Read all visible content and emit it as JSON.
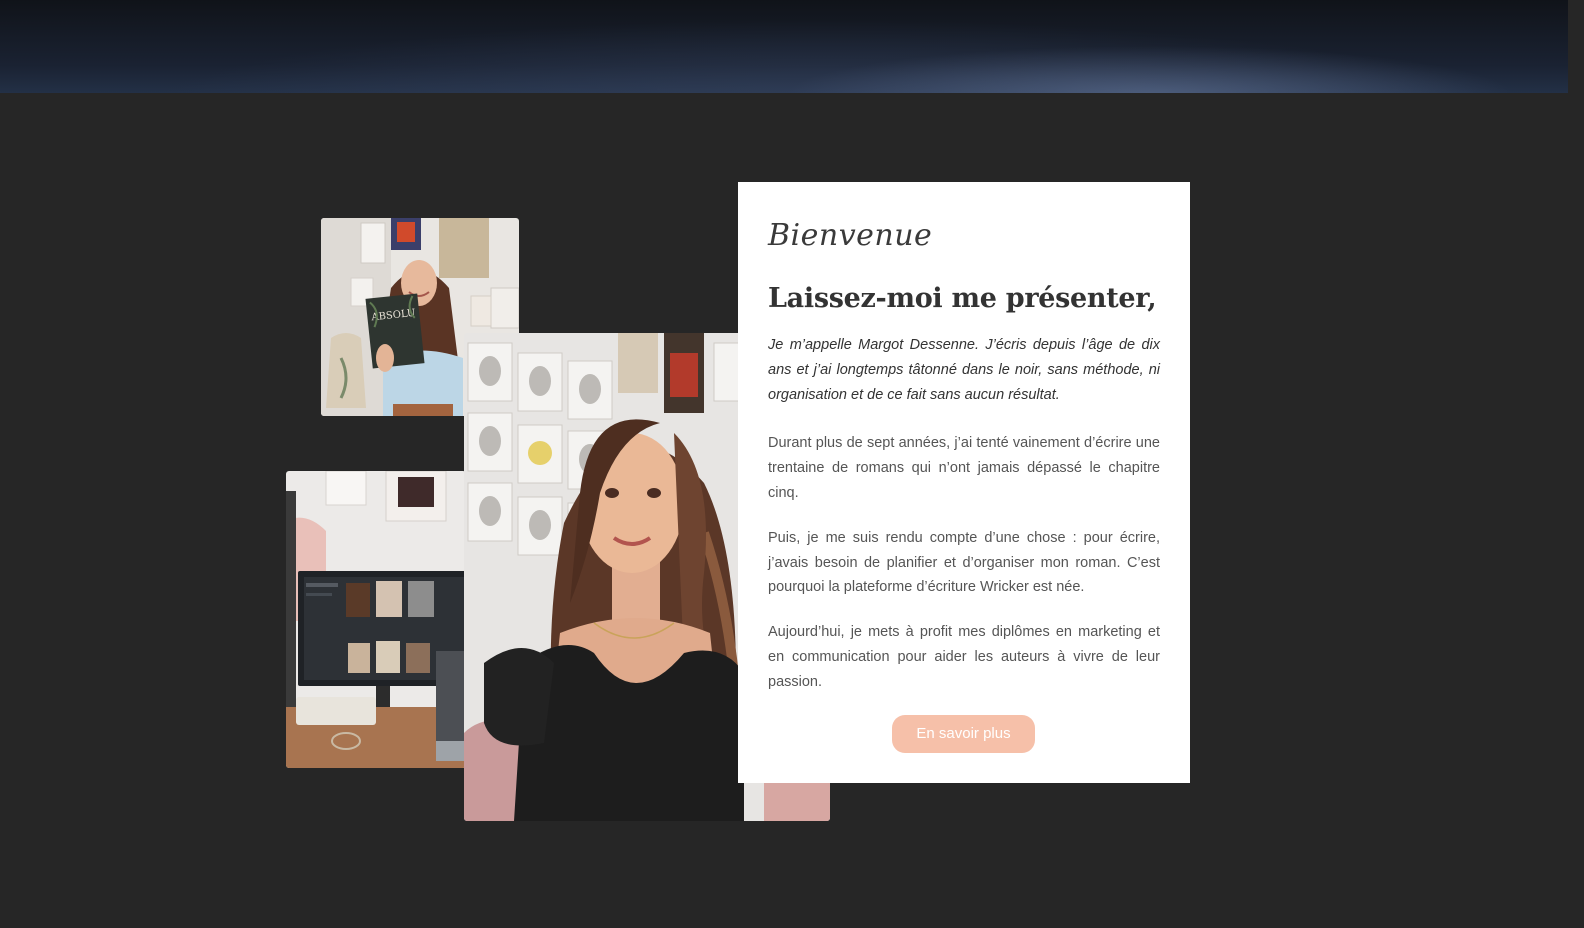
{
  "hero": {
    "background": "dark starry night gradient"
  },
  "gallery": {
    "photos": [
      {
        "name": "author-holding-book-photo",
        "subject": "woman holding a book titled ABSOLU"
      },
      {
        "name": "desk-monitor-photo",
        "subject": "desk with monitor showing character portraits"
      },
      {
        "name": "author-portrait-photo",
        "subject": "smiling woman in black top in front of drawings wall"
      }
    ],
    "book_cover_text": "ABSOLU"
  },
  "about": {
    "eyebrow": "Bienvenue",
    "title": "Laissez-moi me présenter,",
    "intro": "Je m’appelle Margot Dessenne. J’écris depuis l’âge de dix ans et j’ai longtemps tâtonné dans le noir, sans méthode, ni organisation et de ce fait sans aucun résultat.",
    "paragraphs": [
      "Durant plus de sept années, j’ai tenté vainement d’écrire une trentaine de romans qui n’ont jamais dépassé le chapitre cinq.",
      "Puis, je me suis rendu compte d’une chose : pour écrire, j’avais besoin de planifier et d’organiser mon roman. C’est pourquoi la plateforme d’écriture Wricker est née.",
      "Aujourd’hui, je mets à profit mes diplômes en marketing et en communication pour aider les auteurs à vivre de leur passion."
    ],
    "cta_label": "En savoir plus"
  },
  "colors": {
    "page_background": "#262626",
    "card_background": "#ffffff",
    "accent": "#f6c0a9",
    "heading": "#333333",
    "body_text": "#555555"
  }
}
